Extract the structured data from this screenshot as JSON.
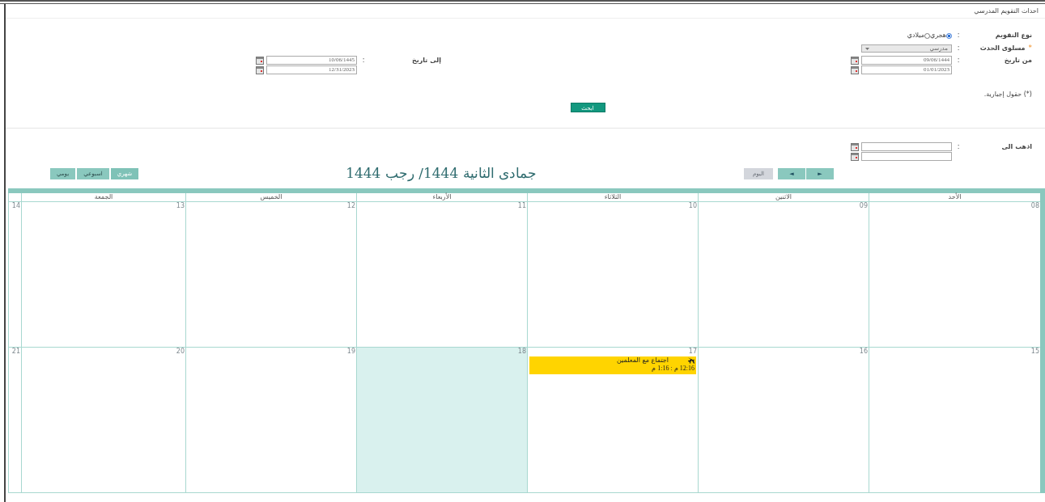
{
  "page_title": "احداث التقويم المدرسي",
  "form": {
    "calendar_type": {
      "label": "نوع التقويم",
      "colon": ":",
      "options": [
        {
          "label": "هجري",
          "selected": true
        },
        {
          "label": "ميلادي",
          "selected": false
        }
      ]
    },
    "event_level": {
      "label": "مسلوى الحدث",
      "colon": ":",
      "required": true,
      "required_mark": "*",
      "value": "مدرسي"
    },
    "from_date": {
      "label": "من تاريخ",
      "colon": ":",
      "hijri": "09/06/1444",
      "gregorian": "01/01/2023"
    },
    "to_date": {
      "label": "إلى تاريخ",
      "colon": ":",
      "hijri": "10/06/1445",
      "gregorian": "12/31/2023"
    },
    "required_note": "(*) حقول إجبارية.",
    "search_button": "ابحث"
  },
  "goto": {
    "label": "اذهب الى",
    "colon": ":"
  },
  "nav": {
    "next": "►",
    "prev": "◄",
    "today": {
      "label": "اليوم",
      "disabled": true
    }
  },
  "title": "جمادى الثانية 1444/ رجب 1444",
  "views": [
    {
      "label": "شهري",
      "selected": true
    },
    {
      "label": "اسبوعي",
      "selected": false
    },
    {
      "label": "يومي",
      "selected": false
    }
  ],
  "calendar": {
    "weekdays": [
      "الأحد",
      "الاثنين",
      "الثلاثاء",
      "الأربعاء",
      "الخميس",
      "الجمعة"
    ],
    "weeks": [
      {
        "days": [
          {
            "date": "08",
            "highlighted": false
          },
          {
            "date": "09",
            "highlighted": false
          },
          {
            "date": "10",
            "highlighted": false
          },
          {
            "date": "11",
            "highlighted": false
          },
          {
            "date": "12",
            "highlighted": false
          },
          {
            "date": "13",
            "highlighted": false
          },
          {
            "date": "14",
            "highlighted": false
          }
        ]
      },
      {
        "days": [
          {
            "date": "15",
            "highlighted": false
          },
          {
            "date": "16",
            "highlighted": false
          },
          {
            "date": "17",
            "highlighted": false,
            "events": [
              {
                "title": "اجتماع مع المعلمين",
                "time": "12:16 م : 1:16 م"
              }
            ]
          },
          {
            "date": "18",
            "highlighted": true
          },
          {
            "date": "19",
            "highlighted": false
          },
          {
            "date": "20",
            "highlighted": false
          },
          {
            "date": "21",
            "highlighted": false
          }
        ]
      }
    ]
  }
}
